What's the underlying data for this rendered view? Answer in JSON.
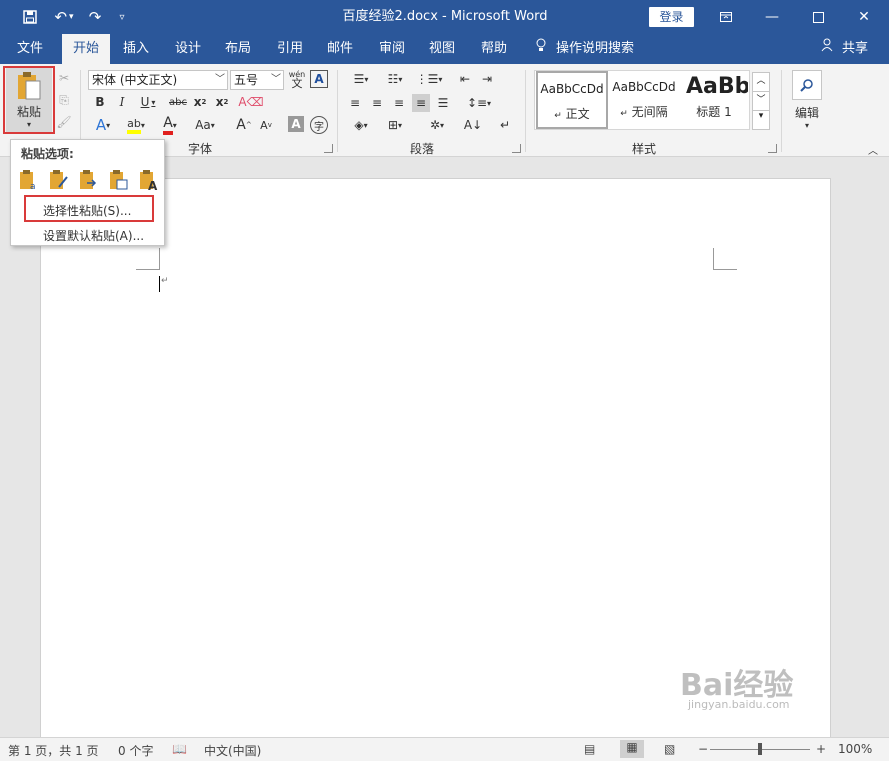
{
  "titlebar": {
    "title": "百度经验2.docx  -  Microsoft Word",
    "login": "登录",
    "save_icon": "save-icon",
    "undo_icon": "undo-icon",
    "redo_icon": "redo-icon"
  },
  "tabs": [
    "文件",
    "开始",
    "插入",
    "设计",
    "布局",
    "引用",
    "邮件",
    "审阅",
    "视图",
    "帮助"
  ],
  "tell_me": "操作说明搜索",
  "share": "共享",
  "clipboard": {
    "paste_label": "粘贴"
  },
  "font": {
    "font_name": "宋体 (中文正文)",
    "font_size": "五号",
    "group_label": "字体",
    "pinyin": "wén"
  },
  "paragraph": {
    "group_label": "段落"
  },
  "styles": {
    "group_label": "样式",
    "items": [
      {
        "preview": "AaBbCcDd",
        "name": "正文"
      },
      {
        "preview": "AaBbCcDd",
        "name": "无间隔"
      },
      {
        "preview": "AaBb",
        "name": "标题 1"
      }
    ]
  },
  "editing": {
    "label": "编辑"
  },
  "paste_popup": {
    "header": "粘贴选项:",
    "item1": "选择性粘贴(S)...",
    "item2": "设置默认粘贴(A)..."
  },
  "statusbar": {
    "page": "第 1 页，共 1 页",
    "words": "0 个字",
    "lang": "中文(中国)",
    "zoom_minus": "−",
    "zoom_plus": "+",
    "zoom": "100%"
  },
  "watermark": {
    "brand": "Bai经验",
    "url": "jingyan.baidu.com"
  },
  "colors": {
    "accent": "#2b579a",
    "highlight_red": "#d93a3a"
  }
}
